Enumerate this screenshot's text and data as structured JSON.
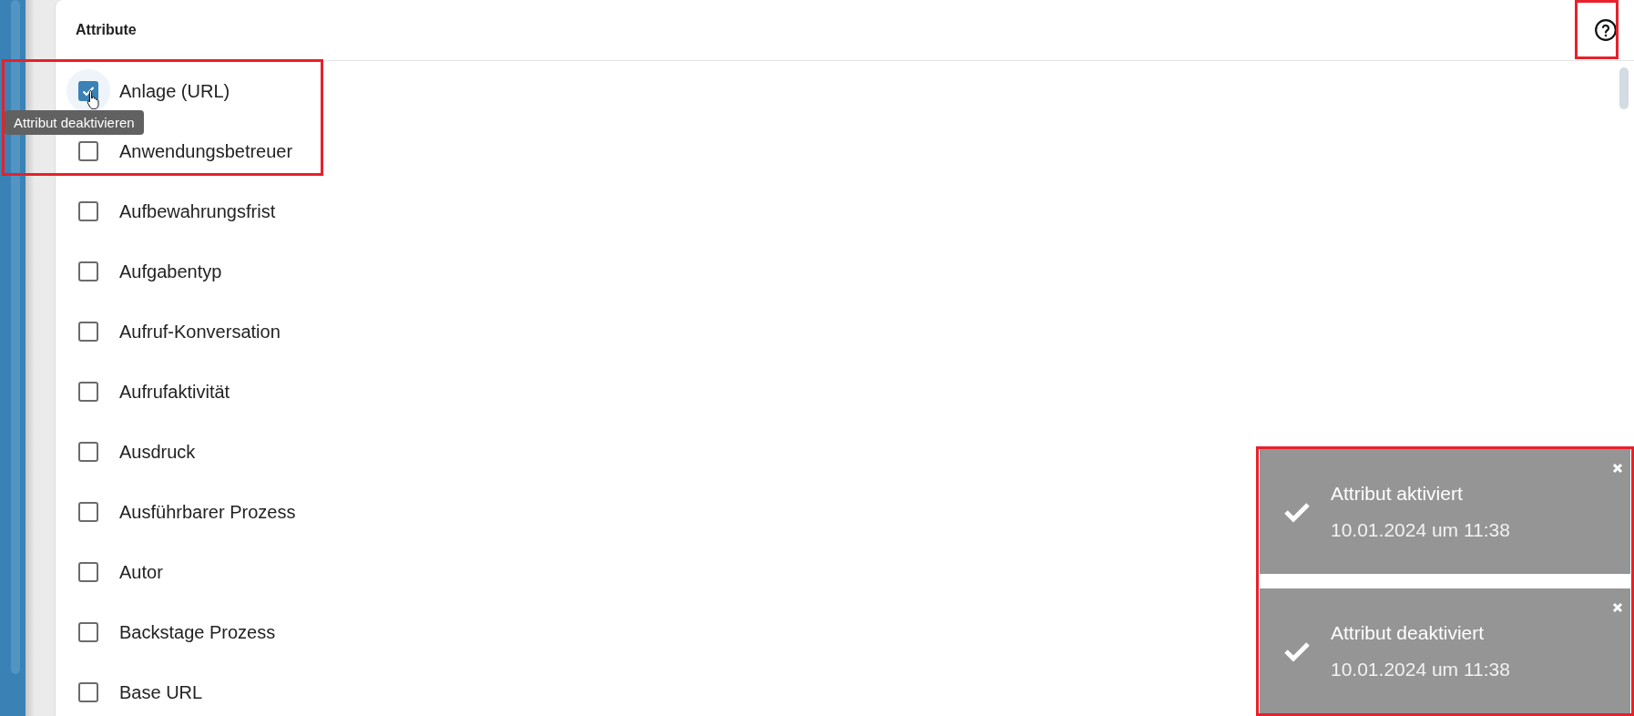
{
  "panel": {
    "title": "Attribute"
  },
  "attributes": [
    {
      "label": "Anlage (URL)",
      "checked": true,
      "hovered": true
    },
    {
      "label": "Anwendungsbetreuer",
      "checked": false,
      "hovered": false
    },
    {
      "label": "Aufbewahrungsfrist",
      "checked": false,
      "hovered": false
    },
    {
      "label": "Aufgabentyp",
      "checked": false,
      "hovered": false
    },
    {
      "label": "Aufruf-Konversation",
      "checked": false,
      "hovered": false
    },
    {
      "label": "Aufrufaktivität",
      "checked": false,
      "hovered": false
    },
    {
      "label": "Ausdruck",
      "checked": false,
      "hovered": false
    },
    {
      "label": "Ausführbarer Prozess",
      "checked": false,
      "hovered": false
    },
    {
      "label": "Autor",
      "checked": false,
      "hovered": false
    },
    {
      "label": "Backstage Prozess",
      "checked": false,
      "hovered": false
    },
    {
      "label": "Base URL",
      "checked": false,
      "hovered": false
    }
  ],
  "tooltip": {
    "text": "Attribut deaktivieren"
  },
  "toasts": [
    {
      "title": "Attribut aktiviert",
      "time": "10.01.2024 um 11:38"
    },
    {
      "title": "Attribut deaktiviert",
      "time": "10.01.2024 um 11:38"
    }
  ]
}
